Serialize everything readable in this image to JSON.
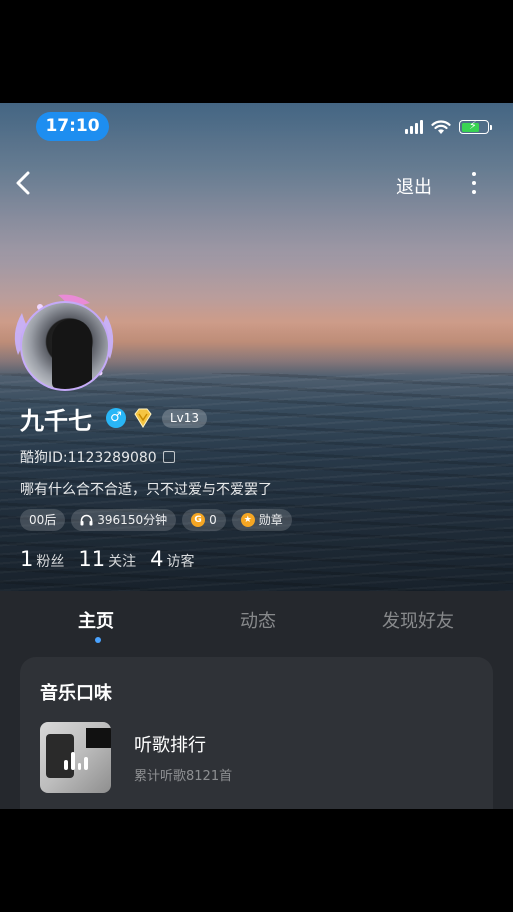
{
  "status_bar": {
    "time": "17:10",
    "battery_level": 0.7
  },
  "nav": {
    "logout_label": "退出"
  },
  "profile": {
    "name": "九千七",
    "gender_symbol": "♂",
    "level": "Lv13",
    "id_text": "酷狗ID:1123289080",
    "signature": "哪有什么合不合适，只不过爱与不爱罢了",
    "tags": {
      "age": "00后",
      "listen_time": "396150分钟",
      "coins": "0",
      "coin_symbol": "G",
      "medal": "勋章"
    },
    "stats": [
      {
        "num": "1",
        "label": "粉丝"
      },
      {
        "num": "11",
        "label": "关注"
      },
      {
        "num": "4",
        "label": "访客"
      }
    ]
  },
  "tabs": [
    {
      "label": "主页",
      "active": true
    },
    {
      "label": "动态",
      "active": false
    },
    {
      "label": "发现好友",
      "active": false
    }
  ],
  "music_card": {
    "title": "音乐口味",
    "ranking_title": "听歌排行",
    "ranking_sub": "累计听歌8121首"
  },
  "colors": {
    "accent": "#1e8ef0",
    "tab_indicator": "#4aa3ff",
    "battery": "#39d353"
  }
}
